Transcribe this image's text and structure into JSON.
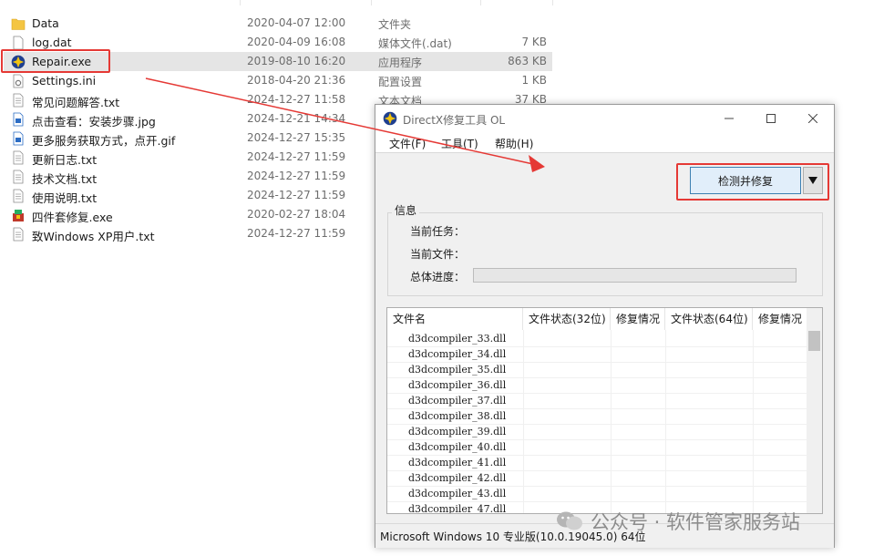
{
  "files": [
    {
      "name": "Data",
      "date": "2020-04-07 12:00",
      "type": "文件夹",
      "size": "",
      "icon": "folder-icon"
    },
    {
      "name": "log.dat",
      "date": "2020-04-09 16:08",
      "type": "媒体文件(.dat)",
      "size": "7 KB",
      "icon": "blank-file-icon"
    },
    {
      "name": "Repair.exe",
      "date": "2019-08-10 16:20",
      "type": "应用程序",
      "size": "863 KB",
      "icon": "repair-app-icon"
    },
    {
      "name": "Settings.ini",
      "date": "2018-04-20 21:36",
      "type": "配置设置",
      "size": "1 KB",
      "icon": "settings-file-icon"
    },
    {
      "name": "常见问题解答.txt",
      "date": "2024-12-27 11:58",
      "type": "文本文档",
      "size": "37 KB",
      "icon": "text-file-icon"
    },
    {
      "name": "点击查看：安装步骤.jpg",
      "date": "2024-12-21 14:34",
      "type": "",
      "size": "",
      "icon": "image-file-icon"
    },
    {
      "name": "更多服务获取方式，点开.gif",
      "date": "2024-12-27 15:35",
      "type": "",
      "size": "",
      "icon": "image-file-icon"
    },
    {
      "name": "更新日志.txt",
      "date": "2024-12-27 11:59",
      "type": "",
      "size": "",
      "icon": "text-file-icon"
    },
    {
      "name": "技术文档.txt",
      "date": "2024-12-27 11:59",
      "type": "",
      "size": "",
      "icon": "text-file-icon"
    },
    {
      "name": "使用说明.txt",
      "date": "2024-12-27 11:59",
      "type": "",
      "size": "",
      "icon": "text-file-icon"
    },
    {
      "name": "四件套修复.exe",
      "date": "2020-02-27 18:04",
      "type": "",
      "size": "",
      "icon": "installer-icon"
    },
    {
      "name": "致Windows XP用户.txt",
      "date": "2024-12-27 11:59",
      "type": "",
      "size": "",
      "icon": "text-file-icon"
    }
  ],
  "dialog": {
    "title": "DirectX修复工具 OL",
    "menu": [
      "文件(F)",
      "工具(T)",
      "帮助(H)"
    ],
    "repair_button": "检测并修复",
    "info_legend": "信息",
    "info_labels": [
      "当前任务：",
      "当前文件：",
      "总体进度："
    ],
    "progress": 0,
    "table_headers": [
      "文件名",
      "文件状态(32位)",
      "修复情况",
      "文件状态(64位)",
      "修复情况"
    ],
    "table_rows": [
      "d3dcompiler_33.dll",
      "d3dcompiler_34.dll",
      "d3dcompiler_35.dll",
      "d3dcompiler_36.dll",
      "d3dcompiler_37.dll",
      "d3dcompiler_38.dll",
      "d3dcompiler_39.dll",
      "d3dcompiler_40.dll",
      "d3dcompiler_41.dll",
      "d3dcompiler_42.dll",
      "d3dcompiler_43.dll",
      "d3dcompiler_47.dll"
    ],
    "status": "Microsoft Windows 10 专业版(10.0.19045.0) 64位"
  },
  "watermark": "公众号 · 软件管家服务站",
  "colors": {
    "highlight": "#e53935",
    "selection": "#e5e5e5",
    "button_accent": "#3c7fb1"
  }
}
